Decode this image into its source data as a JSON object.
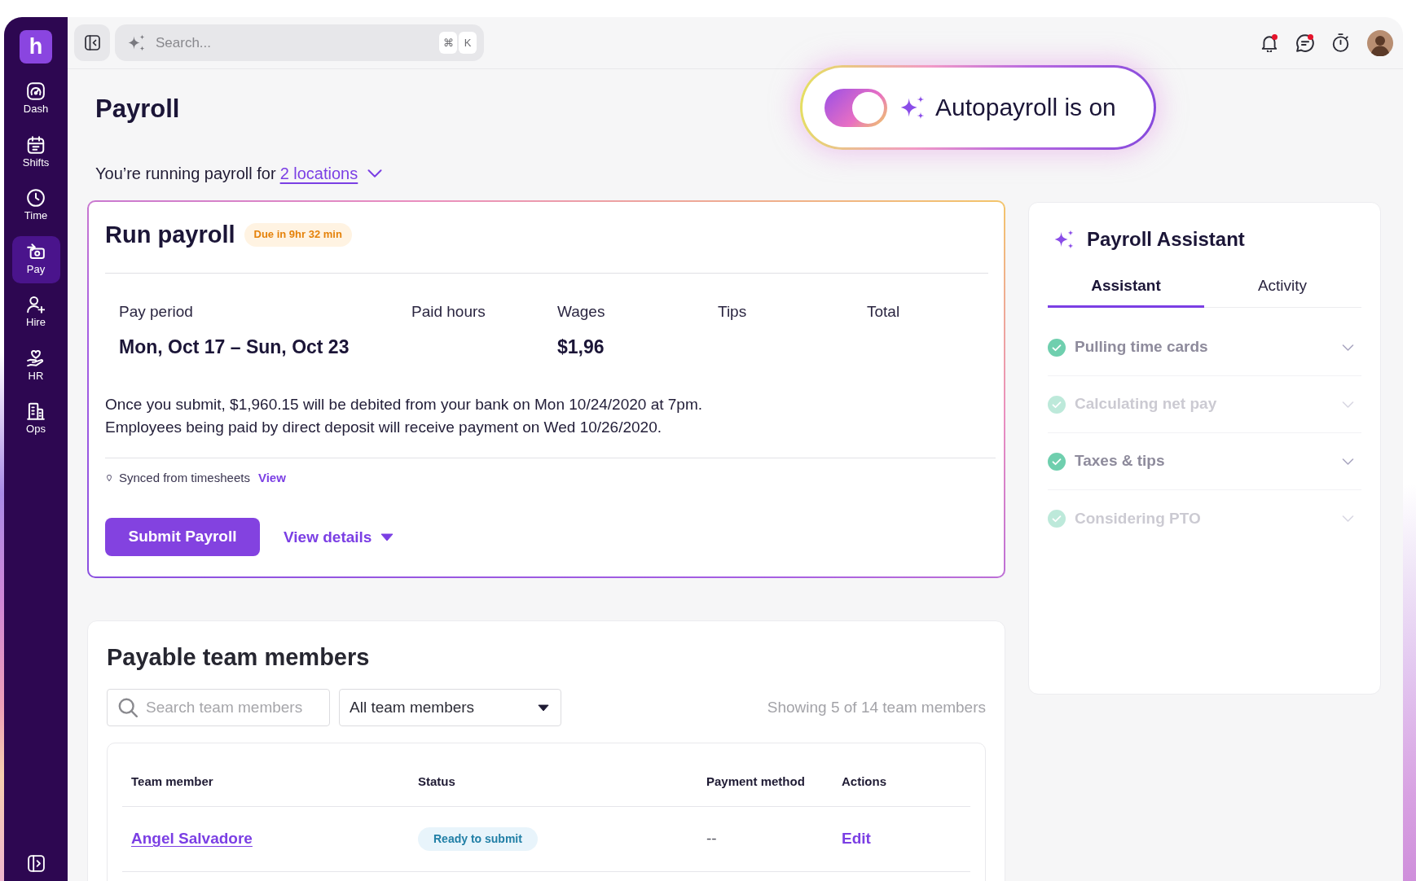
{
  "sidebar": {
    "logo": "h",
    "items": [
      {
        "label": "Dash",
        "selected": false
      },
      {
        "label": "Shifts",
        "selected": false
      },
      {
        "label": "Time",
        "selected": false
      },
      {
        "label": "Pay",
        "selected": true
      },
      {
        "label": "Hire",
        "selected": false
      },
      {
        "label": "HR",
        "selected": false
      },
      {
        "label": "Ops",
        "selected": false
      }
    ]
  },
  "topbar": {
    "search": {
      "placeholder": "Search...",
      "shortcut": [
        "⌘",
        "K"
      ]
    },
    "notifications": {
      "unread": true
    },
    "messages": {
      "unread": true
    }
  },
  "page": {
    "title": "Payroll",
    "scope_text": "You’re running payroll for",
    "locations_link": "2 locations"
  },
  "autopayroll": {
    "label": "Autopayroll is on",
    "on": true
  },
  "run_payroll": {
    "title": "Run payroll",
    "due_badge": "Due in 9hr 32 min",
    "columns": [
      {
        "label": "Pay period",
        "value": "Mon, Oct 17 – Sun, Oct 23"
      },
      {
        "label": "Paid hours"
      },
      {
        "label": "Wages",
        "value": "$1,96"
      },
      {
        "label": "Tips"
      },
      {
        "label": "Total"
      }
    ],
    "notice": [
      "Once you submit, $1,960.15 will be debited from your bank on Mon 10/24/2020 at 7pm.",
      "Employees being paid by direct deposit will receive payment on Wed 10/26/2020."
    ],
    "sync": {
      "text": "Synced from timesheets",
      "link": "View"
    },
    "submit_button": "Submit Payroll",
    "details_link": "View details"
  },
  "assistant": {
    "title": "Payroll Assistant",
    "tabs": [
      {
        "label": "Assistant",
        "selected": true
      },
      {
        "label": "Activity",
        "selected": false
      }
    ],
    "steps": [
      {
        "label": "Pulling time cards",
        "checked": true,
        "disabled": false
      },
      {
        "label": "Calculating net pay",
        "checked": true,
        "disabled": true
      },
      {
        "label": "Taxes & tips",
        "checked": true,
        "disabled": false
      },
      {
        "label": "Considering PTO",
        "checked": true,
        "disabled": true
      }
    ]
  },
  "team": {
    "title": "Payable team members",
    "search": {
      "placeholder": "Search team members"
    },
    "filter": {
      "value": "All team members"
    },
    "count": "Showing 5 of 14 team members",
    "columns": [
      "Team member",
      "Status",
      "Payment method",
      "Actions"
    ],
    "rows": [
      {
        "name": "Angel Salvadore",
        "status": "Ready to submit",
        "payment_method": "--",
        "action": "Edit"
      }
    ]
  }
}
